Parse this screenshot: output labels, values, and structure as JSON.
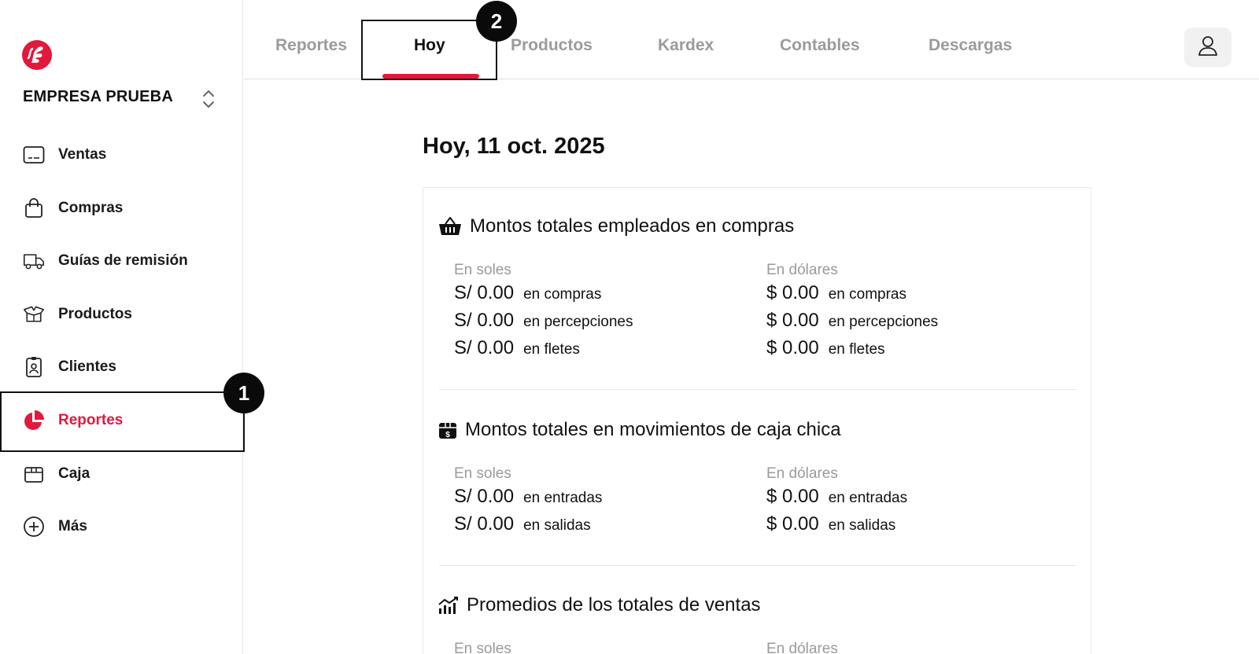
{
  "sidebar": {
    "company_name": "EMPRESA PRUEBA",
    "items": [
      {
        "label": "Ventas",
        "icon": "receipt-icon"
      },
      {
        "label": "Compras",
        "icon": "shopping-bag-icon"
      },
      {
        "label": "Guías de remisión",
        "icon": "truck-icon"
      },
      {
        "label": "Productos",
        "icon": "open-box-icon"
      },
      {
        "label": "Clientes",
        "icon": "id-badge-icon"
      },
      {
        "label": "Reportes",
        "icon": "pie-chart-icon",
        "active": true
      },
      {
        "label": "Caja",
        "icon": "cash-box-icon"
      },
      {
        "label": "Más",
        "icon": "plus-circle-icon"
      }
    ]
  },
  "tabs": [
    {
      "label": "Reportes"
    },
    {
      "label": "Hoy",
      "active": true
    },
    {
      "label": "Productos"
    },
    {
      "label": "Kardex"
    },
    {
      "label": "Contables"
    },
    {
      "label": "Descargas"
    }
  ],
  "badges": {
    "one": "1",
    "two": "2"
  },
  "main": {
    "title": "Hoy, 11 oct. 2025",
    "sections": [
      {
        "title": "Montos totales empleados en compras",
        "icon": "basket-icon",
        "soles_label": "En soles",
        "dolares_label": "En dólares",
        "soles": [
          {
            "amount": "S/ 0.00",
            "desc": "en compras"
          },
          {
            "amount": "S/ 0.00",
            "desc": "en percepciones"
          },
          {
            "amount": "S/ 0.00",
            "desc": "en fletes"
          }
        ],
        "dolares": [
          {
            "amount": "$ 0.00",
            "desc": "en compras"
          },
          {
            "amount": "$ 0.00",
            "desc": "en percepciones"
          },
          {
            "amount": "$ 0.00",
            "desc": "en fletes"
          }
        ]
      },
      {
        "title": "Montos totales en movimientos de caja chica",
        "icon": "cash-box-icon",
        "soles_label": "En soles",
        "dolares_label": "En dólares",
        "soles": [
          {
            "amount": "S/ 0.00",
            "desc": "en entradas"
          },
          {
            "amount": "S/ 0.00",
            "desc": "en salidas"
          }
        ],
        "dolares": [
          {
            "amount": "$ 0.00",
            "desc": "en entradas"
          },
          {
            "amount": "$ 0.00",
            "desc": "en salidas"
          }
        ]
      },
      {
        "title": "Promedios de los totales de ventas",
        "icon": "bar-chart-trend-icon",
        "soles_label": "En soles",
        "dolares_label": "En dólares"
      }
    ]
  },
  "colors": {
    "accent": "#e2183d",
    "muted": "#9b9b9b",
    "text": "#111111"
  }
}
